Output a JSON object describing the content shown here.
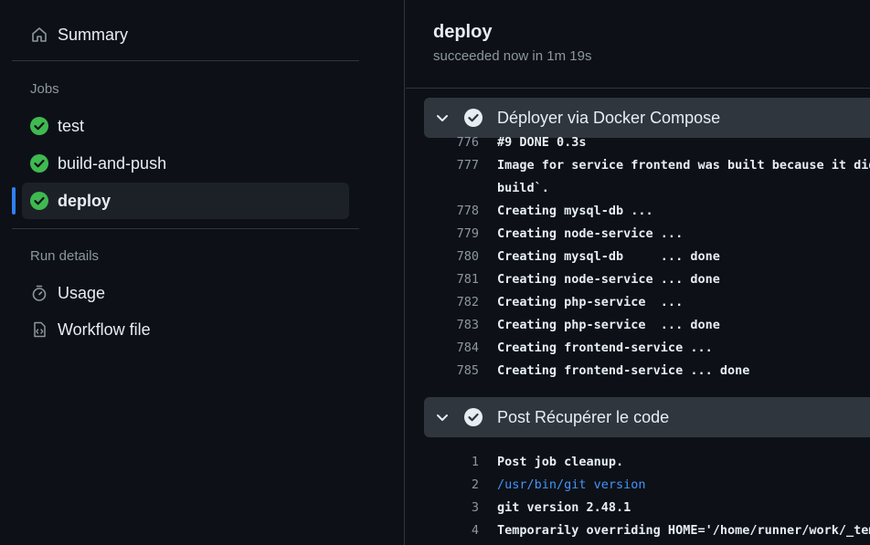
{
  "sidebar": {
    "summary_label": "Summary",
    "jobs_label": "Jobs",
    "jobs": [
      {
        "label": "test",
        "status": "success"
      },
      {
        "label": "build-and-push",
        "status": "success"
      },
      {
        "label": "deploy",
        "status": "success",
        "active": true
      }
    ],
    "run_details_label": "Run details",
    "usage_label": "Usage",
    "workflow_file_label": "Workflow file"
  },
  "job": {
    "title": "deploy",
    "subtitle": "succeeded now in 1m 19s"
  },
  "steps": [
    {
      "name": "Déployer via Docker Compose",
      "lines": [
        {
          "num": "776",
          "text": "#9 DONE 0.3s"
        },
        {
          "num": "777",
          "text": "Image for service frontend was built because it did not already exist. To rebuild this image you must use `docker-compose build` or `docker-compose up --"
        },
        {
          "num": "",
          "text": "build`."
        },
        {
          "num": "778",
          "text": "Creating mysql-db ..."
        },
        {
          "num": "779",
          "text": "Creating node-service ..."
        },
        {
          "num": "780",
          "text": "Creating mysql-db     ... done"
        },
        {
          "num": "781",
          "text": "Creating node-service ... done"
        },
        {
          "num": "782",
          "text": "Creating php-service  ..."
        },
        {
          "num": "783",
          "text": "Creating php-service  ... done"
        },
        {
          "num": "784",
          "text": "Creating frontend-service ..."
        },
        {
          "num": "785",
          "text": "Creating frontend-service ... done"
        }
      ]
    },
    {
      "name": "Post Récupérer le code",
      "lines": [
        {
          "num": "1",
          "text": "Post job cleanup."
        },
        {
          "num": "2",
          "text": "/usr/bin/git version",
          "cmd": true
        },
        {
          "num": "3",
          "text": "git version 2.48.1"
        },
        {
          "num": "4",
          "text": "Temporarily overriding HOME='/home/runner/work/_temp/'"
        }
      ]
    }
  ],
  "colors": {
    "success": "#3fb950",
    "accent": "#2f81f7",
    "command": "#4493f8",
    "background": "#0d1117"
  }
}
